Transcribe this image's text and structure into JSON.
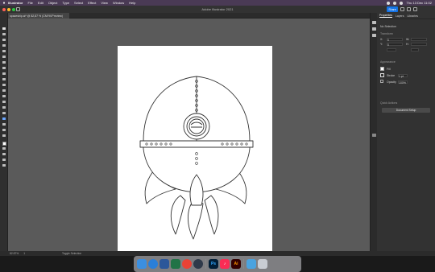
{
  "menubar": {
    "items": [
      "Illustrator",
      "File",
      "Edit",
      "Object",
      "Type",
      "Select",
      "Effect",
      "View",
      "Window",
      "Help"
    ],
    "clock": "Thu 13 Dec 11:02"
  },
  "titlebar": {
    "title": "Adobe Illustrator 2021",
    "share_label": "Share"
  },
  "document": {
    "tab_label": "spaceship.ai* @ 82,87 % (CMYK/Preview)"
  },
  "properties": {
    "tabs": [
      "Properties",
      "Layers",
      "Libraries"
    ],
    "no_selection": "No Selection",
    "transform_header": "Transform",
    "x_label": "X:",
    "x_value": "0",
    "y_label": "Y:",
    "y_value": "0",
    "w_label": "W:",
    "h_label": "H:",
    "appearance_header": "Appearance",
    "fill_label": "Fill",
    "stroke_label": "Stroke",
    "stroke_value": "1 pt",
    "opacity_label": "Opacity",
    "opacity_value": "100%",
    "quick_actions_header": "Quick Actions",
    "quick_action_button": "Document Setup"
  },
  "statusbar": {
    "zoom": "82.87%",
    "artboard": "1",
    "tool": "Toggle Selection"
  },
  "dock": {
    "icons": [
      "finder-icon",
      "safari-icon",
      "word-icon",
      "excel-icon",
      "chrome-icon",
      "mail-icon",
      "photoshop-icon",
      "music-icon",
      "illustrator-icon",
      "downloads-icon",
      "trash-icon"
    ],
    "ps_label": "Ps",
    "ai_label": "Ai"
  },
  "colors": {
    "accent": "#1473e6",
    "canvas": "#5a5a5a",
    "panel": "#323232"
  }
}
